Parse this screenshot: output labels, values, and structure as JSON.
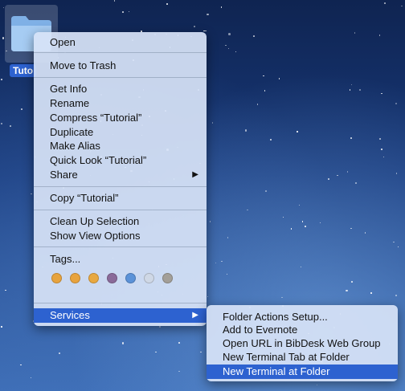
{
  "desktop": {
    "folder": {
      "label": "Tuto",
      "icon": "folder-icon"
    }
  },
  "context_menu": {
    "items": [
      {
        "label": "Open"
      },
      {
        "label": "Move to Trash"
      },
      {
        "label": "Get Info"
      },
      {
        "label": "Rename"
      },
      {
        "label": "Compress “Tutorial”"
      },
      {
        "label": "Duplicate"
      },
      {
        "label": "Make Alias"
      },
      {
        "label": "Quick Look “Tutorial”"
      },
      {
        "label": "Share",
        "submenu_arrow": "▶"
      },
      {
        "label": "Copy “Tutorial”"
      },
      {
        "label": "Clean Up Selection"
      },
      {
        "label": "Show View Options"
      },
      {
        "label": "Tags..."
      },
      {
        "label": "Services",
        "submenu_arrow": "▶"
      }
    ],
    "tag_colors": [
      "#e7a33e",
      "#e8a33e",
      "#e8a840",
      "#8a6a99",
      "#5b92d8",
      "#cfd8e6",
      "#a39f98"
    ],
    "highlight_color": "#2d62d0"
  },
  "services_submenu": {
    "items": [
      {
        "label": "Folder Actions Setup..."
      },
      {
        "label": "Add to Evernote"
      },
      {
        "label": "Open URL in BibDesk Web Group"
      },
      {
        "label": "New Terminal Tab at Folder"
      },
      {
        "label": "New Terminal at Folder"
      }
    ]
  }
}
